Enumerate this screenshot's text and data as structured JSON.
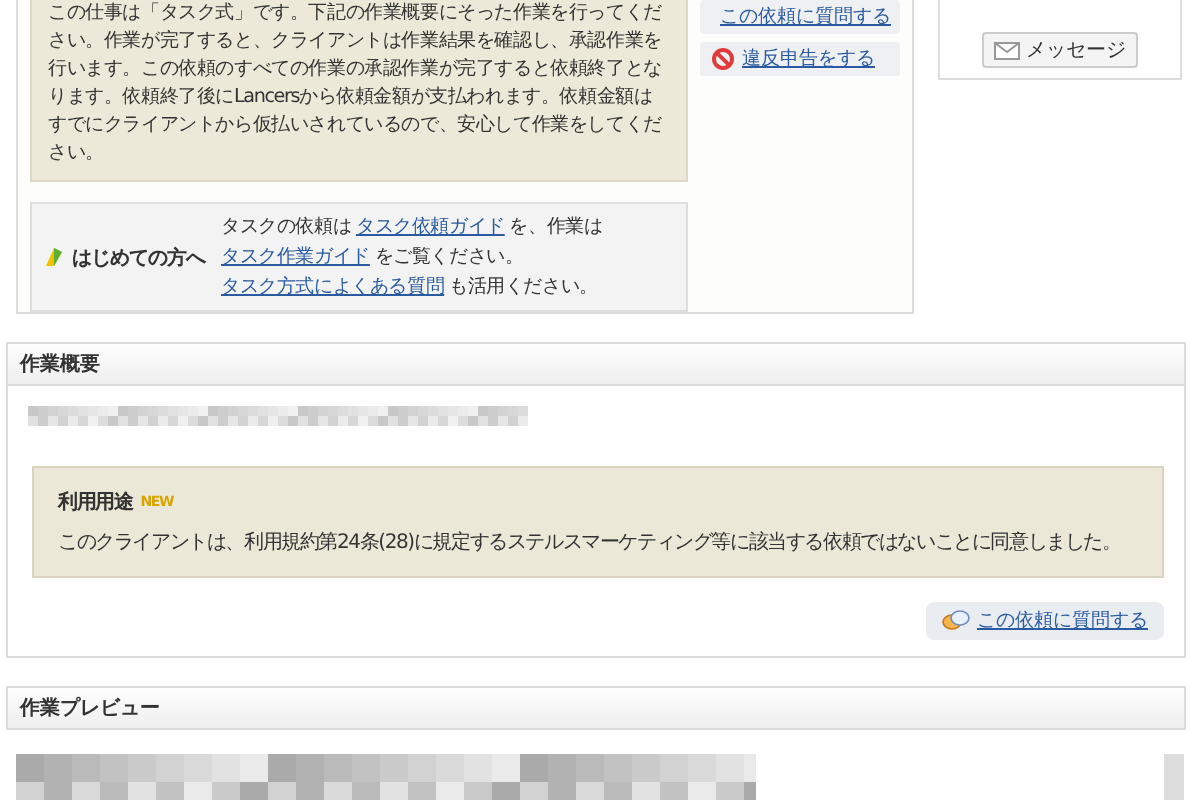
{
  "notice": {
    "text": "この仕事は「タスク式」です。下記の作業概要にそった作業を行ってください。作業が完了すると、クライアントは作業結果を確認し、承認作業を行います。この依頼のすべての作業の承認作業が完了すると依頼終了となります。依頼終了後にLancersから依頼金額が支払われます。依頼金額はすでにクライアントから仮払いされているので、安心して作業をしてください。"
  },
  "side_links": [
    {
      "kind": "question",
      "label": "この依頼に質問する"
    },
    {
      "kind": "report",
      "label": "違反申告をする"
    }
  ],
  "beginner": {
    "title": "はじめての方へ",
    "parts": [
      {
        "kind": "text",
        "text": "タスクの依頼は "
      },
      {
        "kind": "link",
        "text": "タスク依頼ガイド"
      },
      {
        "kind": "text",
        "text": " を、作業は "
      },
      {
        "kind": "link",
        "text": "タスク作業ガイド"
      },
      {
        "kind": "text",
        "text": " をご覧ください。"
      },
      {
        "kind": "link",
        "text": "タスク方式によくある質問"
      },
      {
        "kind": "text",
        "text": " も活用ください。"
      }
    ]
  },
  "message_button": {
    "label": "メッセージ"
  },
  "summary": {
    "title": "作業概要",
    "usage": {
      "title": "利用用途",
      "badge": "NEW",
      "text": "このクライアントは、利用規約第24条(28)に規定するステルスマーケティング等に該当する依頼ではないことに同意しました。"
    },
    "question_link": "この依頼に質問する"
  },
  "preview": {
    "title": "作業プレビュー"
  }
}
